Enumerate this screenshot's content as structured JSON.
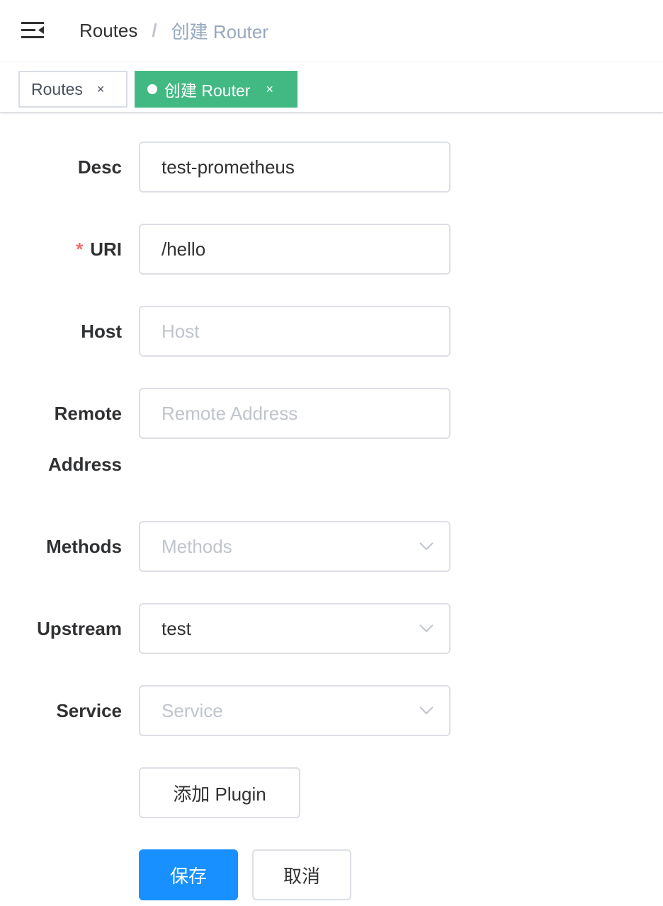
{
  "navbar": {
    "menu_icon": "hamburger-menu-icon",
    "breadcrumb": {
      "first": "Routes",
      "separator": "/",
      "current": "创建 Router"
    }
  },
  "tags": [
    {
      "label": "Routes",
      "close": "×",
      "active": false
    },
    {
      "label": "创建 Router",
      "close": "×",
      "active": true
    }
  ],
  "form": {
    "desc": {
      "label": "Desc",
      "value": "test-prometheus",
      "placeholder": ""
    },
    "uri": {
      "label": "URI",
      "required_mark": "*",
      "value": "/hello",
      "placeholder": ""
    },
    "host": {
      "label": "Host",
      "value": "",
      "placeholder": "Host"
    },
    "remote_address": {
      "label_line1": "Remote",
      "label_line2": "Address",
      "value": "",
      "placeholder": "Remote Address"
    },
    "methods": {
      "label": "Methods",
      "value": "",
      "placeholder": "Methods"
    },
    "upstream": {
      "label": "Upstream",
      "value": "test",
      "placeholder": ""
    },
    "service": {
      "label": "Service",
      "value": "",
      "placeholder": "Service"
    }
  },
  "buttons": {
    "add_plugin": "添加 Plugin",
    "save": "保存",
    "cancel": "取消"
  },
  "colors": {
    "active_tag": "#42b983",
    "primary": "#1890ff",
    "required": "#f56c6c"
  }
}
